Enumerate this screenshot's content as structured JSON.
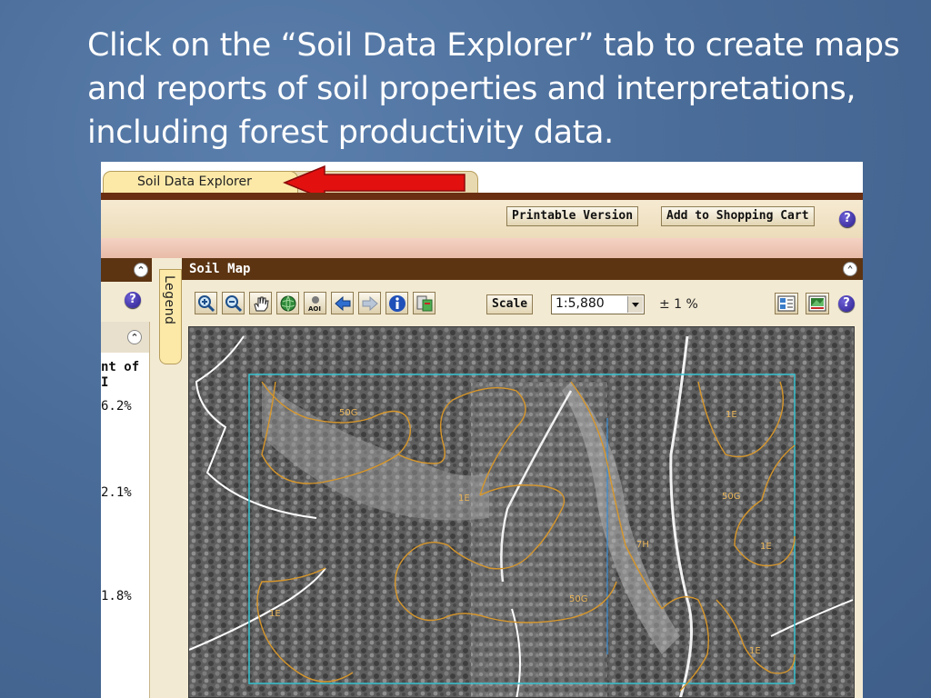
{
  "slide": {
    "line1": "Click on the “Soil Data Explorer” tab to create maps",
    "line2": "and reports of soil properties and interpretations,",
    "line3": "including forest productivity data."
  },
  "tabs": {
    "active_label": "Soil Data Explorer"
  },
  "toolbar": {
    "printable_label": "Printable Version",
    "cart_label": "Add to Shopping Cart",
    "help_glyph": "?"
  },
  "left_panel": {
    "collapse_glyph": "⌃",
    "header_line1": "nt of",
    "header_line2": "I",
    "values": [
      "6.2%",
      "2.1%",
      "1.8%"
    ]
  },
  "legend": {
    "label": "Legend"
  },
  "soil_map": {
    "title": "Soil Map",
    "scale_label": "Scale",
    "scale_value": "1:5,880",
    "precision": "± 1 %",
    "tools": [
      "zoom-in-icon",
      "zoom-out-icon",
      "pan-hand-icon",
      "globe-icon",
      "aoi-icon",
      "back-arrow-icon",
      "forward-arrow-icon",
      "info-icon",
      "identify-icon"
    ],
    "map_units": [
      "50G",
      "1E",
      "50G",
      "7H",
      "1E",
      "1E",
      "50G",
      "1E",
      "1E"
    ]
  },
  "colors": {
    "slide_bg": "#4a6c98",
    "tab_bar": "#6a2f12",
    "panel_header": "#5c3412",
    "accent_red": "#e31010",
    "soil_line": "#d6962b",
    "aoi_box": "#36c3d0"
  }
}
